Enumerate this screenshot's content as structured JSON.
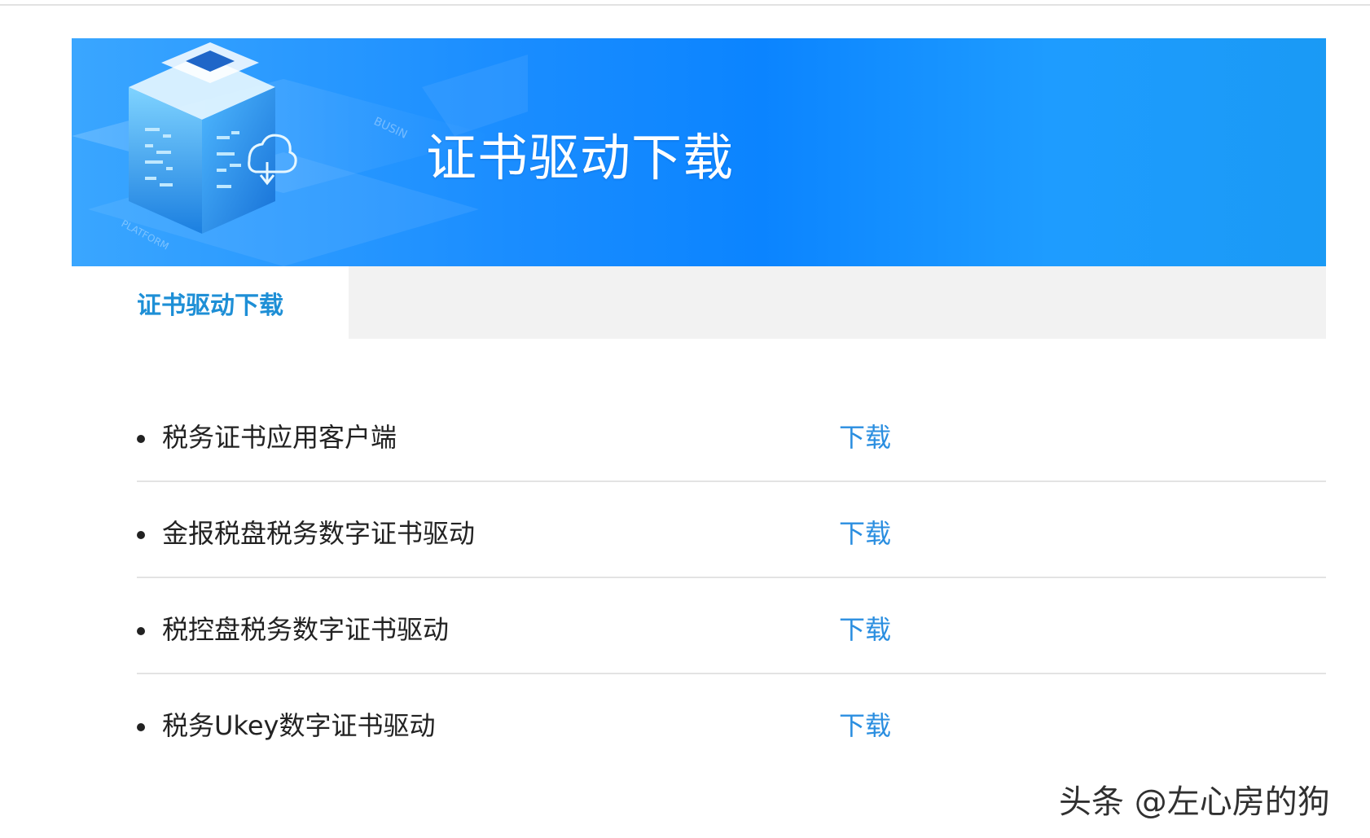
{
  "banner": {
    "title": "证书驱动下载",
    "art_icon": "cube-cloud-download-illustration",
    "art_text_1": "BUSIN",
    "art_text_2": "PLATFORM"
  },
  "tabs": [
    {
      "label": "证书驱动下载",
      "active": true
    }
  ],
  "downloads": [
    {
      "name": "税务证书应用客户端",
      "action": "下载"
    },
    {
      "name": "金报税盘税务数字证书驱动",
      "action": "下载"
    },
    {
      "name": "税控盘税务数字证书驱动",
      "action": "下载"
    },
    {
      "name": "税务Ukey数字证书驱动",
      "action": "下载"
    }
  ],
  "watermark": "头条 @左心房的狗",
  "colors": {
    "banner_blue": "#0b84ff",
    "accent_text": "#1e8fd6",
    "link": "#2a8ee0",
    "tab_bar_bg": "#f2f2f2",
    "divider": "#e3e3e3"
  }
}
